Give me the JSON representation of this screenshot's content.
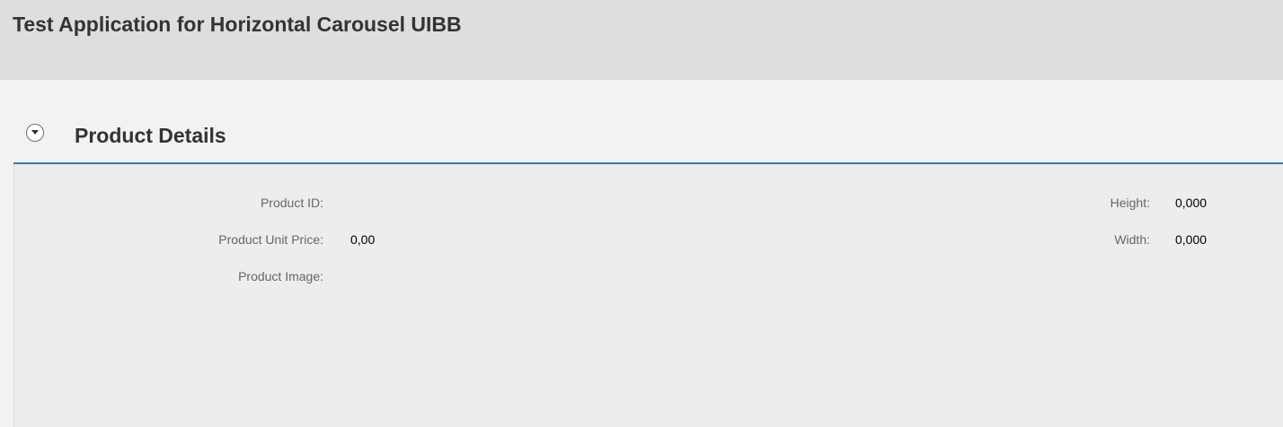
{
  "header": {
    "title": "Test Application for Horizontal Carousel UIBB"
  },
  "panel": {
    "title": "Product Details",
    "left_fields": [
      {
        "label": "Product ID:",
        "value": ""
      },
      {
        "label": "Product Unit Price:",
        "value": "0,00"
      },
      {
        "label": "Product Image:",
        "value": ""
      }
    ],
    "right_fields": [
      {
        "label": "Height:",
        "value": "0,000"
      },
      {
        "label": "Width:",
        "value": "0,000"
      }
    ]
  },
  "colors": {
    "header_bg": "#dedede",
    "panel_underline": "#2b7cbf",
    "body_bg": "#ededed"
  },
  "icons": {
    "collapse": "chevron-down-circle-icon"
  }
}
